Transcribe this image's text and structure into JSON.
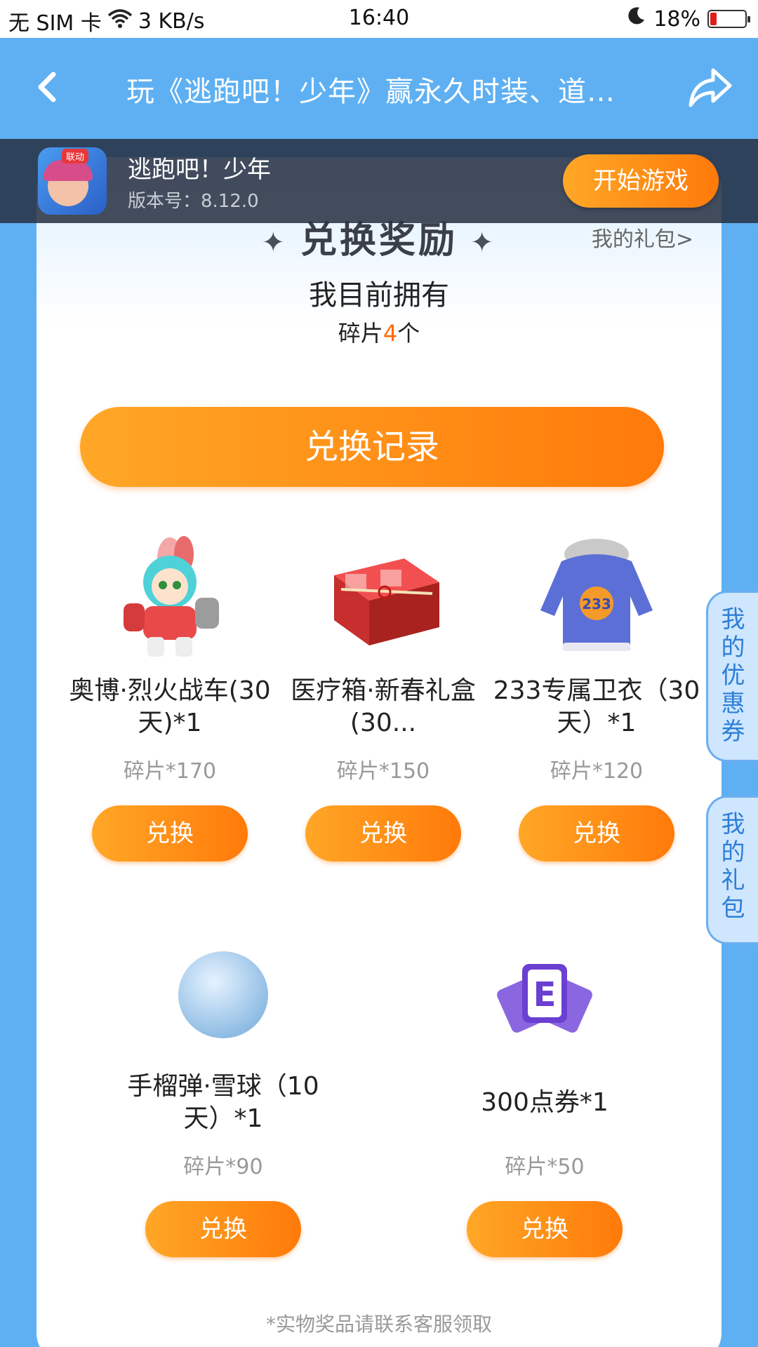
{
  "status_bar": {
    "carrier": "无 SIM 卡",
    "net_speed": "3 KB/s",
    "time": "16:40",
    "battery": "18%",
    "battery_level": 0.18
  },
  "header": {
    "title": "玩《逃跑吧！少年》赢永久时装、道…",
    "back_icon": "chevron-left-icon",
    "share_icon": "share-icon"
  },
  "game": {
    "name": "逃跑吧！少年",
    "version": "版本号：8.12.0",
    "icon_tag": "联动",
    "start_label": "开始游戏"
  },
  "rewards": {
    "title": "兑换奖励",
    "my_gift_link": "我的礼包>",
    "own_title": "我目前拥有",
    "own_prefix": "碎片",
    "own_count": "4",
    "own_suffix": "个",
    "record_label": "兑换记录",
    "items": [
      {
        "name": "奥博·烈火战车(30天)*1",
        "cost": "碎片*170",
        "button": "兑换"
      },
      {
        "name": "医疗箱·新春礼盒(30...",
        "cost": "碎片*150",
        "button": "兑换"
      },
      {
        "name": "233专属卫衣（30天）*1",
        "cost": "碎片*120",
        "button": "兑换"
      },
      {
        "name": "手榴弹·雪球（10天）*1",
        "cost": "碎片*90",
        "button": "兑换"
      },
      {
        "name": "300点券*1",
        "cost": "碎片*50",
        "button": "兑换"
      }
    ],
    "footnote": "*实物奖品请联系客服领取"
  },
  "side_tabs": {
    "coupons": "我的优惠券",
    "gifts": "我的礼包"
  },
  "colors": {
    "primary_blue": "#5fb0f2",
    "orange_start": "#ffa726",
    "orange_end": "#ff7a0a",
    "highlight": "#ff6a00"
  }
}
